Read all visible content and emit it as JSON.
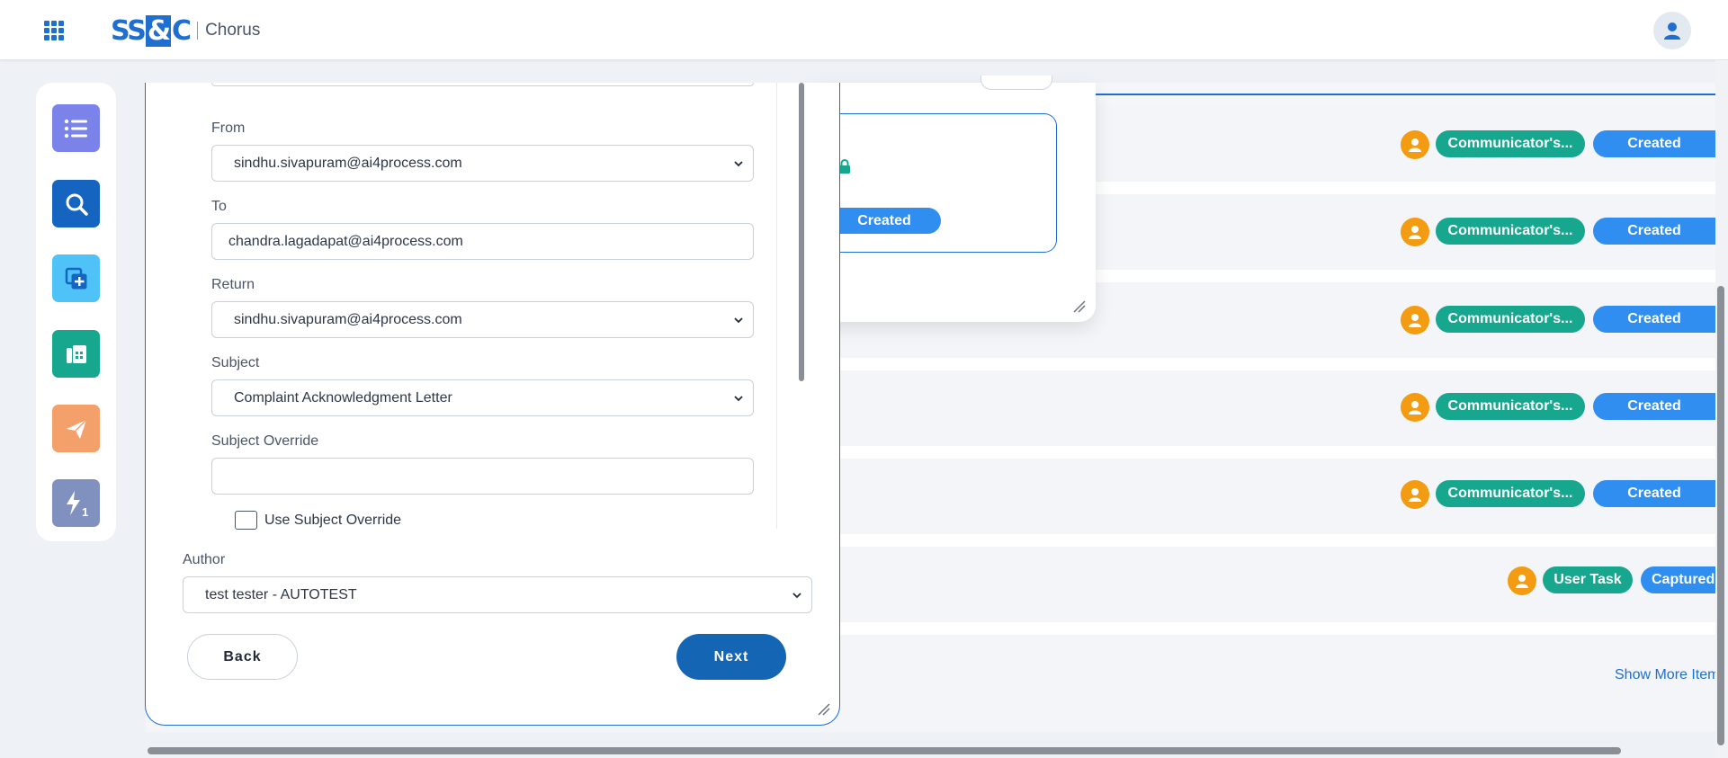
{
  "header": {
    "logo_text": "SS&C",
    "product_name": "Chorus"
  },
  "leftnav": {
    "items": [
      {
        "name": "worklist",
        "color": "#7b83eb"
      },
      {
        "name": "search",
        "color": "#1565c0"
      },
      {
        "name": "create",
        "color": "#4fc3f7"
      },
      {
        "name": "fax",
        "color": "#17a78f"
      },
      {
        "name": "send",
        "color": "#f4a06a"
      },
      {
        "name": "flash-1",
        "color": "#8091c0",
        "badge": "1"
      }
    ]
  },
  "background_list": {
    "rows": [
      {
        "type": "Communicator's...",
        "status": "Created"
      },
      {
        "type": "Communicator's...",
        "status": "Created"
      },
      {
        "type": "Communicator's...",
        "status": "Created"
      },
      {
        "type": "Communicator's...",
        "status": "Created"
      },
      {
        "type": "Communicator's...",
        "status": "Created"
      },
      {
        "type": "User Task",
        "status": "Captured"
      }
    ],
    "show_more": "Show More Items"
  },
  "mid_card": {
    "status": "Created"
  },
  "form": {
    "from_label": "From",
    "from_value": "sindhu.sivapuram@ai4process.com",
    "to_label": "To",
    "to_value": "chandra.lagadapat@ai4process.com",
    "return_label": "Return",
    "return_value": "sindhu.sivapuram@ai4process.com",
    "subject_label": "Subject",
    "subject_value": "Complaint Acknowledgment Letter",
    "subject_override_label": "Subject Override",
    "subject_override_value": "",
    "use_subject_override_label": "Use Subject Override",
    "use_subject_override_checked": false,
    "author_label": "Author",
    "author_value": "test tester - AUTOTEST",
    "back_label": "Back",
    "next_label": "Next"
  },
  "colors": {
    "brand_blue": "#1f6fd1",
    "primary_button": "#1565b5",
    "status_blue": "#2f8ef0",
    "type_green": "#17a78f",
    "person_orange": "#f39c12"
  }
}
